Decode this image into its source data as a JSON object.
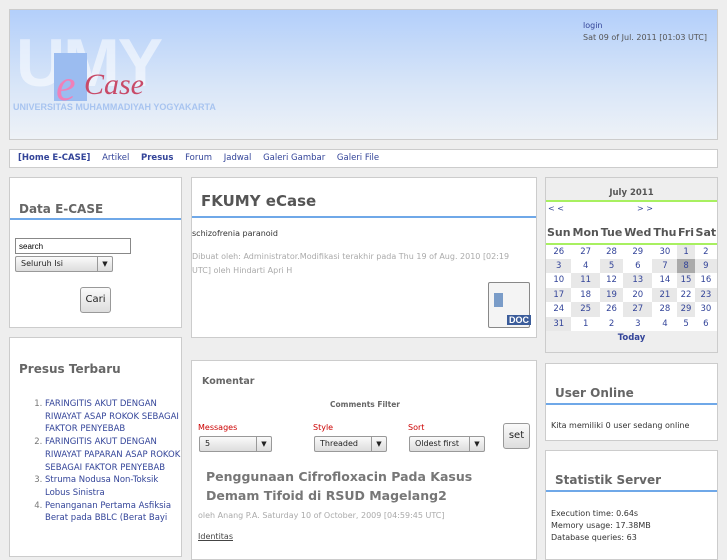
{
  "header": {
    "logo_text": "eCase",
    "watermark": "UMY",
    "university": "UNIVERSITAS MUHAMMADIYAH YOGYAKARTA",
    "login": "login",
    "datetime": "Sat 09 of Jul. 2011 [01:03 UTC]"
  },
  "nav": {
    "items": [
      "[Home E-CASE]",
      "Artikel",
      "Presus",
      "Forum",
      "Jadwal",
      "Galeri Gambar",
      "Galeri File"
    ]
  },
  "left": {
    "data_title": "Data E-CASE",
    "search_value": "search",
    "scope": "Seluruh Isi",
    "search_button": "Cari",
    "presus_title": "Presus Terbaru",
    "presus": [
      "FARINGITIS AKUT DENGAN RIWAYAT ASAP ROKOK SEBAGAI FAKTOR PENYEBAB",
      "FARINGITIS AKUT DENGAN RIWAYAT PAPARAN ASAP ROKOK SEBAGAI FAKTOR PENYEBAB",
      "Struma Nodusa Non-Toksik Lobus Sinistra",
      "Penanganan Pertama Asfiksia Berat pada BBLC (Berat Bayi"
    ]
  },
  "main": {
    "title": "FKUMY eCase",
    "body": "schizofrenia paranoid",
    "meta": "Dibuat oleh: Administrator.Modifikasi terakhir pada Thu 19 of Aug. 2010 [02:19 UTC] oleh Hindarti Apri H",
    "doc_label": "DOC"
  },
  "comments": {
    "title": "Komentar",
    "filter_title": "Comments Filter",
    "messages_label": "Messages",
    "messages_value": "5",
    "style_label": "Style",
    "style_value": "Threaded",
    "sort_label": "Sort",
    "sort_value": "Oldest first",
    "set_button": "set",
    "post_title": "Penggunaan Cifrofloxacin Pada Kasus Demam Tifoid di RSUD Magelang2",
    "post_meta": "oleh Anang P.A. Saturday 10 of October, 2009 [04:59:45 UTC]",
    "post_link": "Identitas"
  },
  "calendar": {
    "title": "July 2011",
    "prev": "< <",
    "next": "> >",
    "days": [
      "Sun",
      "Mon",
      "Tue",
      "Wed",
      "Thu",
      "Fri",
      "Sat"
    ],
    "weeks": [
      [
        26,
        27,
        28,
        29,
        30,
        1,
        2
      ],
      [
        3,
        4,
        5,
        6,
        7,
        8,
        9
      ],
      [
        10,
        11,
        12,
        13,
        14,
        15,
        16
      ],
      [
        17,
        18,
        19,
        20,
        21,
        22,
        23
      ],
      [
        24,
        25,
        26,
        27,
        28,
        29,
        30
      ],
      [
        31,
        1,
        2,
        3,
        4,
        5,
        6
      ]
    ],
    "today_day": 8,
    "today": "Today"
  },
  "online": {
    "title": "User Online",
    "text": "Kita memiliki 0 user sedang online"
  },
  "stats": {
    "title": "Statistik Server",
    "lines": [
      "Execution time: 0.64s",
      "Memory usage: 17.38MB",
      "Database queries: 63"
    ]
  }
}
